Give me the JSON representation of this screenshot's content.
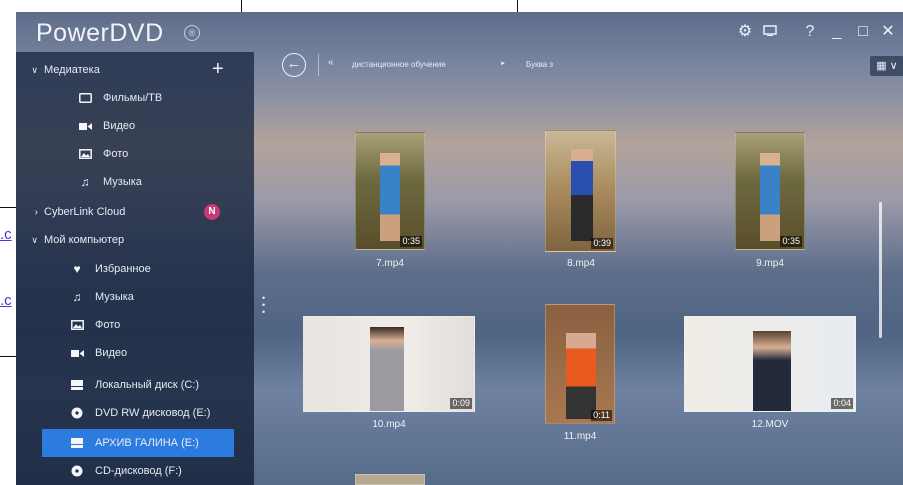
{
  "document": {
    "link_fragment_1": ".c",
    "link_fragment_2": ".c"
  },
  "app": {
    "title": "PowerDVD",
    "title_badge": "®",
    "window_controls": {
      "settings_icon": "gear-icon",
      "screen_icon": "screen-icon",
      "help": "?",
      "minimize": "_",
      "maximize": "□",
      "close": "✕"
    }
  },
  "sidebar": {
    "library_header": "Медиатека",
    "add_label": "+",
    "library_items": [
      {
        "label": "Фильмы/ТВ",
        "icon": "tv-icon"
      },
      {
        "label": "Видео",
        "icon": "video-camera-icon"
      },
      {
        "label": "Фото",
        "icon": "photo-icon"
      },
      {
        "label": "Музыка",
        "icon": "music-note-icon"
      }
    ],
    "cloud_label": "CyberLink Cloud",
    "cloud_badge": "N",
    "computer_header": "Мой компьютер",
    "computer_items": [
      {
        "label": "Избранное",
        "icon": "heart-icon"
      },
      {
        "label": "Музыка",
        "icon": "music-note-icon"
      },
      {
        "label": "Фото",
        "icon": "photo-icon"
      },
      {
        "label": "Видео",
        "icon": "video-camera-icon"
      },
      {
        "label": "Локальный диск (C:)",
        "icon": "disk-drive-icon"
      },
      {
        "label": "DVD RW дисковод (E:)",
        "icon": "optical-disc-icon"
      },
      {
        "label": "АРХИВ ГАЛИНА (E:)",
        "icon": "disk-drive-icon",
        "selected": true
      },
      {
        "label": "CD-дисковод (F:)",
        "icon": "optical-disc-icon"
      }
    ]
  },
  "toolbar": {
    "back_icon": "back-arrow-icon",
    "crumb_prefix": "«",
    "crumb_1": "дистанционное обучение",
    "crumb_sep": "►",
    "crumb_2": "Буква з",
    "view_label": "▦ ∨"
  },
  "files": [
    {
      "name": "7.mp4",
      "duration": "0:35"
    },
    {
      "name": "8.mp4",
      "duration": "0:39"
    },
    {
      "name": "9.mp4",
      "duration": "0:35"
    },
    {
      "name": "10.mp4",
      "duration": "0:09"
    },
    {
      "name": "11.mp4",
      "duration": "0:11"
    },
    {
      "name": "12.MOV",
      "duration": "0:04"
    }
  ],
  "colors": {
    "selected_row": "#2c7ce0",
    "sidebar_bg": "#1f2d47",
    "cloud_badge": "#c83a74"
  }
}
